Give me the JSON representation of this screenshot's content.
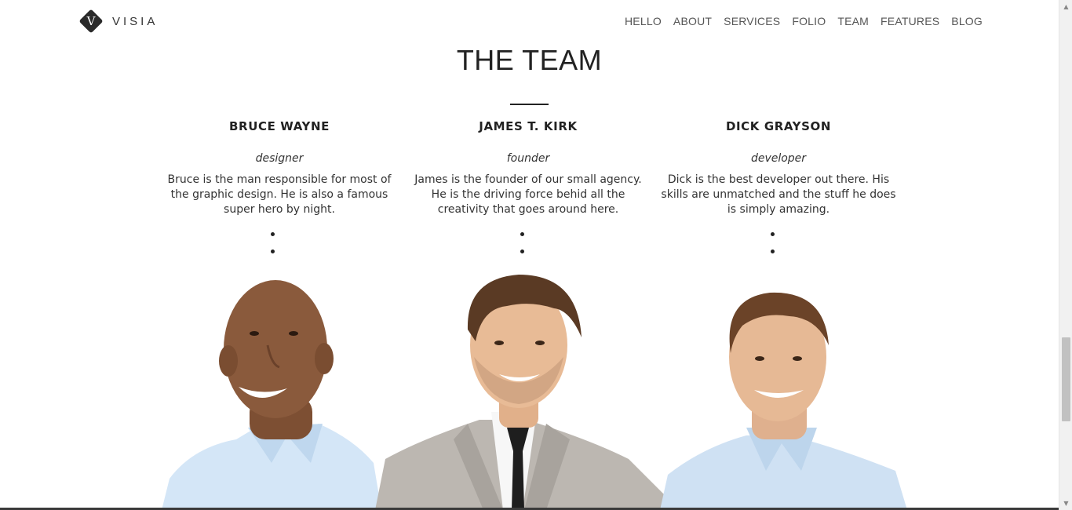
{
  "brand": {
    "logo_letter": "V",
    "name": "VISIA"
  },
  "nav": [
    {
      "label": "HELLO"
    },
    {
      "label": "ABOUT"
    },
    {
      "label": "SERVICES"
    },
    {
      "label": "FOLIO"
    },
    {
      "label": "TEAM"
    },
    {
      "label": "FEATURES"
    },
    {
      "label": "BLOG"
    }
  ],
  "section": {
    "title": "THE TEAM"
  },
  "team": [
    {
      "name": "BRUCE WAYNE",
      "role": "designer",
      "bio": "Bruce is the man responsible for most of the graphic design. He is also a famous super hero by night."
    },
    {
      "name": "JAMES T. KIRK",
      "role": "founder",
      "bio": "James is the founder of our small agency. He is the driving force behid all the creativity that goes around here."
    },
    {
      "name": "DICK GRAYSON",
      "role": "developer",
      "bio": "Dick is the best developer out there. His skills are unmatched and the stuff he does is simply amazing."
    }
  ],
  "colors": {
    "text": "#222222",
    "nav": "#555555",
    "shirt_blue": "#cfe3f5",
    "suit_gray": "#b9b5b0",
    "skin_dark": "#8a5a3c",
    "skin_light": "#e3b896",
    "hair_brown": "#5a3a24"
  }
}
